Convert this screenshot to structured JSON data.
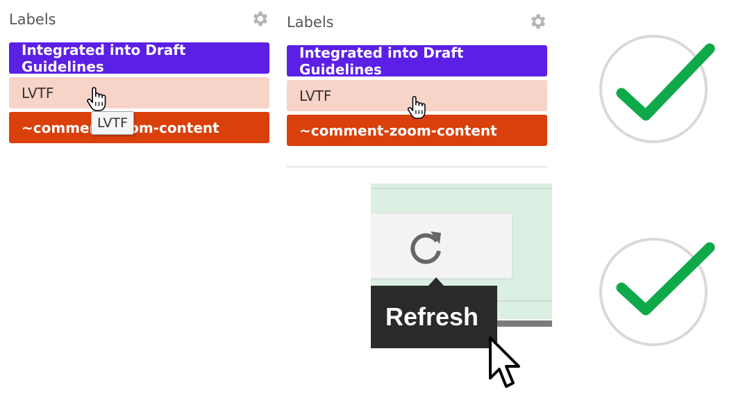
{
  "left_panel": {
    "title": "Labels",
    "labels": [
      "Integrated into Draft Guidelines",
      "LVTF",
      "~comment-zoom-content"
    ],
    "tooltip": "LVTF"
  },
  "middle_panel": {
    "title": "Labels",
    "labels": [
      "Integrated into Draft Guidelines",
      "LVTF",
      "~comment-zoom-content"
    ]
  },
  "refresh_panel": {
    "tooltip": "Refresh"
  },
  "icons": {
    "settings": "gear-icon",
    "refresh": "refresh-icon",
    "hand_cursor": "hand-cursor-icon",
    "arrow_cursor": "arrow-cursor-icon",
    "check": "checkmark-icon"
  },
  "colors": {
    "label_purple": "#5b1fe6",
    "label_peach": "#f8d3c8",
    "label_orange": "#d9400b",
    "check_green": "#0fa94a",
    "circle_gray": "#d9d9d9"
  }
}
